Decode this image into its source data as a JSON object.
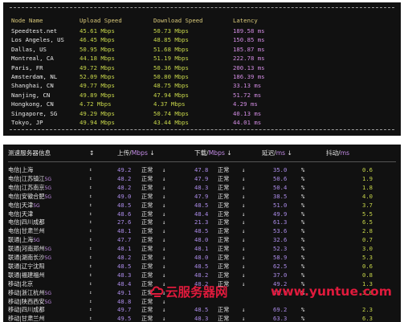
{
  "speedtest1": {
    "headers": [
      "Node Name",
      "Upload Speed",
      "Download Speed",
      "Latency"
    ],
    "rows": [
      [
        "Speedtest.net",
        "45.61 Mbps",
        "50.73 Mbps",
        "189.58 ms"
      ],
      [
        "Los Angeles, US",
        "46.45 Mbps",
        "48.85 Mbps",
        "150.85 ms"
      ],
      [
        "Dallas, US",
        "50.95 Mbps",
        "51.68 Mbps",
        "185.87 ms"
      ],
      [
        "Montreal, CA",
        "44.18 Mbps",
        "51.19 Mbps",
        "222.78 ms"
      ],
      [
        "Paris, FR",
        "49.72 Mbps",
        "50.36 Mbps",
        "200.13 ms"
      ],
      [
        "Amsterdam, NL",
        "52.09 Mbps",
        "50.80 Mbps",
        "186.39 ms"
      ],
      [
        "Shanghai, CN",
        "49.77 Mbps",
        "48.75 Mbps",
        "33.13 ms"
      ],
      [
        "Nanjing, CN",
        "49.89 Mbps",
        "47.94 Mbps",
        "51.72 ms"
      ],
      [
        "Hongkong, CN",
        "4.72 Mbps",
        "4.37 Mbps",
        "4.29 ms"
      ],
      [
        "Singapore, SG",
        "49.29 Mbps",
        "50.74 Mbps",
        "40.13 ms"
      ],
      [
        "Tokyo, JP",
        "49.94 Mbps",
        "43.44 Mbps",
        "44.01 ms"
      ]
    ]
  },
  "speedtest2": {
    "header": {
      "node": "测速服务器信息",
      "rev": "↕",
      "upload": "上传/",
      "download": "下载/",
      "latency": "延迟/",
      "jitter": "抖动/",
      "unit_mbps": "Mbps",
      "unit_ms": "ms",
      "arrow": "↓"
    },
    "rev_mark": "↕",
    "ok": "正常",
    "arrow": "↓",
    "pct": "%",
    "rows": [
      {
        "node": "电信|上海",
        "g5": "",
        "up": "49.2",
        "down": "47.8",
        "lat": "35.0",
        "jit": "0.6"
      },
      {
        "node": "电信|江苏镇江",
        "g5": "5G",
        "up": "48.2",
        "down": "47.9",
        "lat": "50.6",
        "jit": "1.9"
      },
      {
        "node": "电信|江苏南京",
        "g5": "5G",
        "up": "48.2",
        "down": "48.3",
        "lat": "50.4",
        "jit": "1.8"
      },
      {
        "node": "电信|安徽合肥",
        "g5": "5G",
        "up": "49.0",
        "down": "47.9",
        "lat": "38.5",
        "jit": "4.0"
      },
      {
        "node": "电信|天津",
        "g5": "5G",
        "up": "48.5",
        "down": "48.5",
        "lat": "51.0",
        "jit": "3.7"
      },
      {
        "node": "电信|天津",
        "g5": "",
        "up": "48.6",
        "down": "48.4",
        "lat": "49.9",
        "jit": "5.5"
      },
      {
        "node": "电信|四川成都",
        "g5": "",
        "up": "27.6",
        "down": "21.3",
        "lat": "61.3",
        "jit": "6.5"
      },
      {
        "node": "电信|甘肃兰州",
        "g5": "",
        "up": "48.1",
        "down": "48.5",
        "lat": "53.6",
        "jit": "2.8"
      },
      {
        "node": "联通|上海",
        "g5": "5G",
        "up": "47.7",
        "down": "48.0",
        "lat": "32.6",
        "jit": "0.7"
      },
      {
        "node": "联通|河南郑州",
        "g5": "5G",
        "up": "48.1",
        "down": "48.1",
        "lat": "52.3",
        "jit": "3.0"
      },
      {
        "node": "联通|湖南长沙",
        "g5": "5G",
        "up": "48.2",
        "down": "48.0",
        "lat": "58.9",
        "jit": "5.3"
      },
      {
        "node": "联通|辽宁沈阳",
        "g5": "",
        "up": "48.5",
        "down": "48.5",
        "lat": "62.5",
        "jit": "0.6"
      },
      {
        "node": "联通|福建福州",
        "g5": "",
        "up": "48.3",
        "down": "48.2",
        "lat": "37.0",
        "jit": "0.8"
      },
      {
        "node": "移动|北京",
        "g5": "",
        "up": "48.4",
        "down": "48.2",
        "lat": "49.2",
        "jit": "1.3"
      },
      {
        "node": "移动|浙江杭州",
        "g5": "5G",
        "up": "49.1",
        "down": "",
        "lat": "35.1",
        "jit": "3.0"
      },
      {
        "node": "移动|陕西西安",
        "g5": "5G",
        "up": "48.8",
        "down": "",
        "lat": "",
        "jit": ""
      },
      {
        "node": "移动|四川成都",
        "g5": "",
        "up": "49.7",
        "down": "48.5",
        "lat": "69.2",
        "jit": "2.3"
      },
      {
        "node": "移动|甘肃兰州",
        "g5": "",
        "up": "49.5",
        "down": "48.3",
        "lat": "63.3",
        "jit": "6.3"
      }
    ]
  },
  "watermark": {
    "site_name": "云服务器网",
    "url": "www.yuntue.com"
  },
  "colors": {
    "terminal_bg": "#111111",
    "node_text": "#eaeaea",
    "header_text": "#d9c97a",
    "speed_value": "#c7d64a",
    "latency_value": "#d08be0",
    "value_purple": "#ab8be8",
    "watermark_red": "#e01a3c"
  }
}
